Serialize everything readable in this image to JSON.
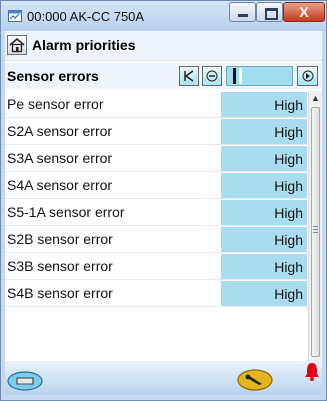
{
  "window": {
    "title": "00:000 AK-CC 750A",
    "close_label": "X"
  },
  "header": {
    "title": "Alarm priorities"
  },
  "section": {
    "title": "Sensor errors",
    "rows": [
      {
        "label": "Pe sensor error",
        "value": "High"
      },
      {
        "label": "S2A sensor error",
        "value": "High"
      },
      {
        "label": "S3A sensor error",
        "value": "High"
      },
      {
        "label": "S4A sensor error",
        "value": "High"
      },
      {
        "label": "S5-1A sensor error",
        "value": "High"
      },
      {
        "label": "S2B sensor error",
        "value": "High"
      },
      {
        "label": "S3B sensor error",
        "value": "High"
      },
      {
        "label": "S4B sensor error",
        "value": "High"
      }
    ]
  },
  "icons": {
    "app": "app-window-icon",
    "home": "home-icon",
    "first": "first-page-icon",
    "prev": "previous-icon",
    "next": "next-icon",
    "footer_left": "controller-icon",
    "footer_tool": "wrench-icon",
    "alarm": "alarm-bell-icon"
  },
  "colors": {
    "value_cell": "#a9dcee",
    "alarm": "#e3001b",
    "footer_button": "#e3b51e"
  }
}
